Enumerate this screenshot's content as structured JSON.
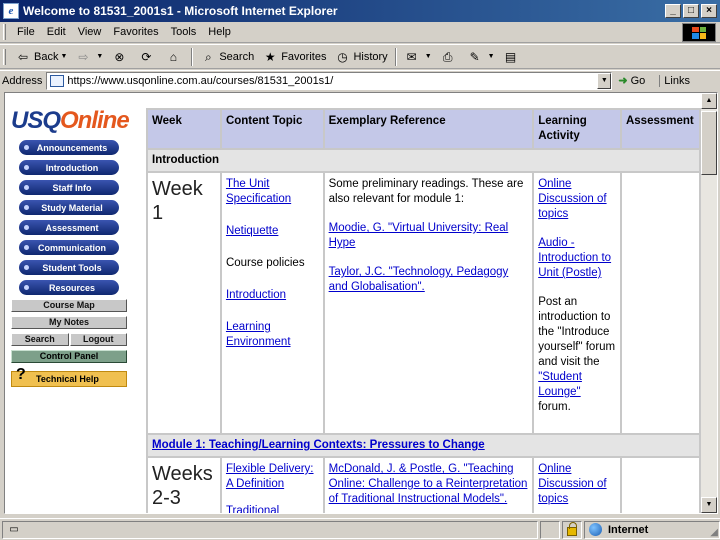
{
  "window": {
    "title": "Welcome to 81531_2001s1 - Microsoft Internet Explorer",
    "buttons": [
      "_",
      "□",
      "×"
    ]
  },
  "menubar": {
    "items": [
      {
        "label": "File"
      },
      {
        "label": "Edit"
      },
      {
        "label": "View"
      },
      {
        "label": "Favorites"
      },
      {
        "label": "Tools"
      },
      {
        "label": "Help"
      }
    ]
  },
  "toolbar": {
    "back": "Back",
    "search": "Search",
    "favorites": "Favorites",
    "history": "History"
  },
  "addressbar": {
    "label": "Address",
    "url": "https://www.usqonline.com.au/courses/81531_2001s1/",
    "go": "Go",
    "links": "Links"
  },
  "sidebar": {
    "logo_usq": "USQ",
    "logo_online": "Online",
    "nav": [
      {
        "label": "Announcements"
      },
      {
        "label": "Introduction"
      },
      {
        "label": "Staff Info"
      },
      {
        "label": "Study Material"
      },
      {
        "label": "Assessment"
      },
      {
        "label": "Communication"
      },
      {
        "label": "Student Tools"
      },
      {
        "label": "Resources"
      }
    ],
    "course_map": "Course Map",
    "my_notes": "My Notes",
    "search": "Search",
    "logout": "Logout",
    "control_panel": "Control Panel",
    "help_icon": "?",
    "technical_help": "Technical Help"
  },
  "table": {
    "headers": [
      "Week",
      "Content Topic",
      "Exemplary Reference",
      "Learning Activity",
      "Assessment"
    ],
    "section_intro": "Introduction",
    "week1": {
      "week": "Week 1",
      "topics": [
        "The Unit Specification",
        "Netiquette",
        "Course policies",
        "Introduction",
        "Learning Environment"
      ],
      "ref_intro": "Some preliminary readings. These are also relevant for module 1:",
      "refs": [
        "Moodie, G. \"Virtual University: Real Hype",
        "Taylor, J.C. \"Technology, Pedagogy and Globalisation\"."
      ],
      "act1": "Online Discussion of topics",
      "act2": "Audio - Introduction to Unit (Postle)",
      "act3_pre": "Post an introduction to the \"Introduce yourself\" forum and visit the ",
      "act3_link": "\"Student Lounge\"",
      "act3_post": " forum."
    },
    "section_module1": "Module 1: Teaching/Learning Contexts: Pressures to Change",
    "weeks23": {
      "week": "Weeks 2-3",
      "topics": [
        "Flexible Delivery: A Definition",
        "Traditional Models"
      ],
      "ref": "McDonald, J. & Postle, G. \"Teaching Online: Challenge to a Reinterpretation of Traditional Instructional Models\".",
      "act1": "Online Discussion of topics"
    }
  },
  "statusbar": {
    "zone": "Internet"
  },
  "colors": {
    "titlebar": "#0a246a",
    "nav_pill": "#1c3c8c",
    "header_cell": "#c4c8e8",
    "help_button": "#f0c050",
    "link": "#0000cc"
  }
}
